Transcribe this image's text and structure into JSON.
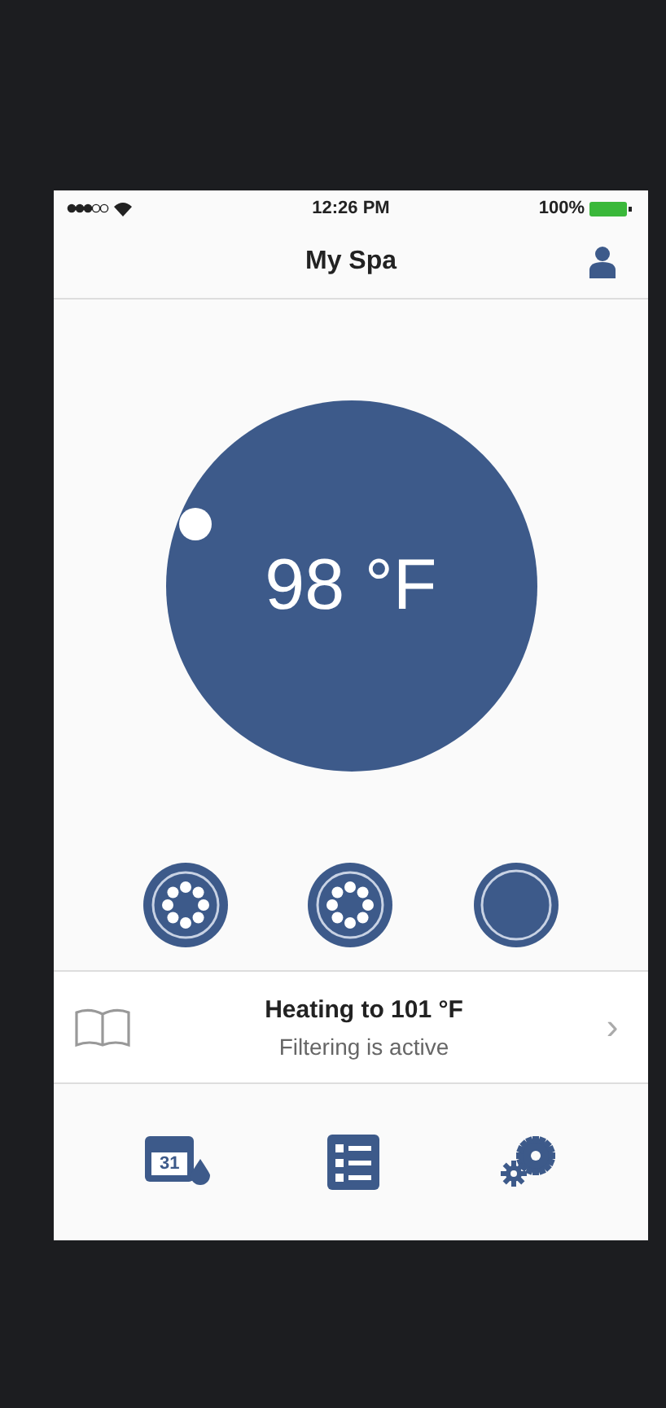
{
  "status_bar": {
    "time": "12:26 PM",
    "battery": "100%"
  },
  "header": {
    "title": "My Spa"
  },
  "dial": {
    "temperature": "98 °F"
  },
  "controls": [
    {
      "kind": "jet"
    },
    {
      "kind": "jet"
    },
    {
      "kind": "plain"
    }
  ],
  "status": {
    "title": "Heating to 101 °F",
    "subtitle": "Filtering is active",
    "chevron": "›"
  },
  "tab_bar": {
    "calendar_day": "31"
  }
}
